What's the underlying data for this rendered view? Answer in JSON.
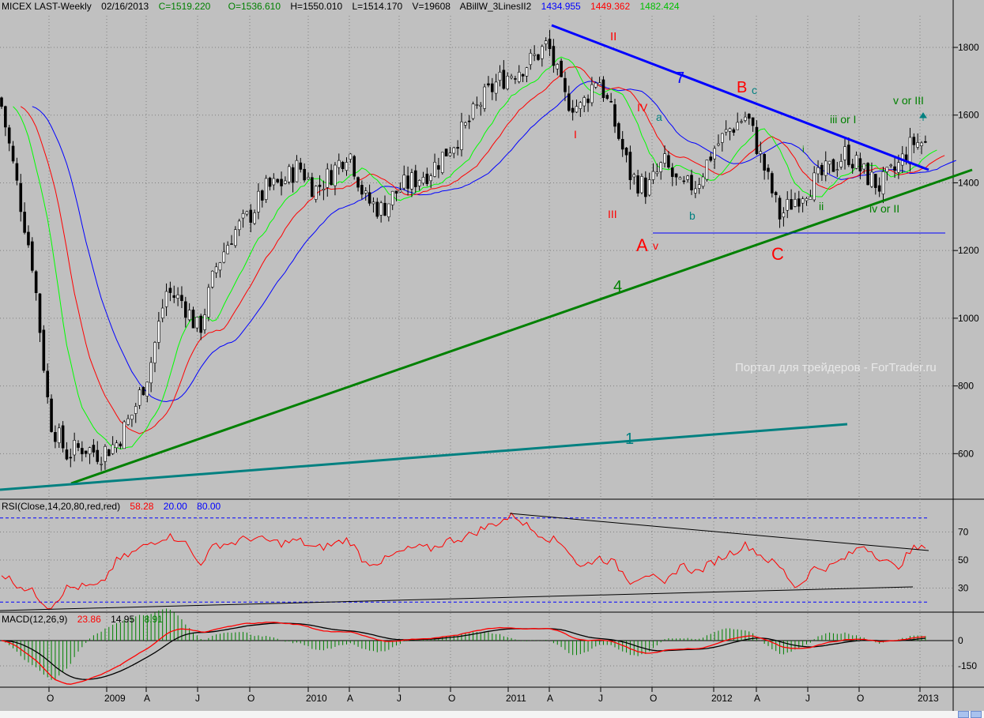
{
  "header": {
    "symbol": "MICEX LAST-Weekly",
    "date": "02/16/2013",
    "close": "C=1519.220",
    "open": "O=1536.610",
    "high": "H=1550.010",
    "low": "L=1514.170",
    "volume": "V=19608",
    "indicator": "ABillW_3LinesII2",
    "ind_v1": "1434.955",
    "ind_v2": "1449.362",
    "ind_v3": "1482.424"
  },
  "rsi_header": {
    "label": "RSI(Close,14,20,80,red,red)",
    "value": "58.28",
    "low": "20.00",
    "high": "80.00"
  },
  "macd_header": {
    "label": "MACD(12,26,9)",
    "macd": "23.86",
    "signal": "14.95",
    "hist": "8.91"
  },
  "watermark": "Портал для трейдеров - ForTrader.ru",
  "colors": {
    "bg": "#c0c0c0",
    "jaw": "#0000ff",
    "teeth": "#ff0000",
    "lips": "#00ff00",
    "line7": "#0000ff",
    "line4": "#008000",
    "line1": "#008080"
  },
  "price_axis": [
    "1800",
    "1600",
    "1400",
    "1200",
    "1000",
    "800",
    "600"
  ],
  "rsi_axis": [
    "70",
    "50",
    "30"
  ],
  "macd_axis": [
    "0",
    "-150"
  ],
  "date_axis": [
    "O",
    "2009",
    "A",
    "J",
    "O",
    "2010",
    "A",
    "J",
    "O",
    "2011",
    "A",
    "J",
    "O",
    "2012",
    "A",
    "J",
    "O",
    "2013"
  ],
  "wave_labels": {
    "II": "II",
    "seven": "7",
    "B": "B",
    "c": "c",
    "IV": "IV",
    "a": "a",
    "I": "I",
    "III": "III",
    "b": "b",
    "A": "A",
    "v": "v",
    "C": "C",
    "four": "4",
    "one": "1",
    "iii": "iii or I",
    "vIII": "v or III",
    "i": "i",
    "ii": "ii",
    "ivII": "iv or II"
  },
  "chart_data": {
    "type": "candlestick",
    "title": "MICEX LAST-Weekly",
    "ylim": [
      450,
      1900
    ],
    "months": [
      "2008-07",
      "2008-08",
      "2008-09",
      "2008-10",
      "2008-11",
      "2008-12",
      "2009-01",
      "2009-02",
      "2009-03",
      "2009-04",
      "2009-05",
      "2009-06",
      "2009-07",
      "2009-08",
      "2009-09",
      "2009-10",
      "2009-11",
      "2009-12",
      "2010-01",
      "2010-02",
      "2010-03",
      "2010-04",
      "2010-05",
      "2010-06",
      "2010-07",
      "2010-08",
      "2010-09",
      "2010-10",
      "2010-11",
      "2010-12",
      "2011-01",
      "2011-02",
      "2011-03",
      "2011-04",
      "2011-05",
      "2011-06",
      "2011-07",
      "2011-08",
      "2011-09",
      "2011-10",
      "2011-11",
      "2011-12",
      "2012-01",
      "2012-02",
      "2012-03",
      "2012-04",
      "2012-05",
      "2012-06",
      "2012-07",
      "2012-08",
      "2012-09",
      "2012-10",
      "2012-11",
      "2012-12",
      "2013-01",
      "2013-02"
    ],
    "monthly_close": [
      1650,
      1400,
      1150,
      700,
      600,
      620,
      600,
      630,
      720,
      850,
      1080,
      1050,
      960,
      1150,
      1250,
      1300,
      1380,
      1400,
      1450,
      1380,
      1430,
      1500,
      1350,
      1320,
      1380,
      1410,
      1440,
      1500,
      1560,
      1640,
      1700,
      1730,
      1760,
      1810,
      1650,
      1620,
      1720,
      1580,
      1420,
      1380,
      1460,
      1380,
      1400,
      1500,
      1560,
      1600,
      1450,
      1300,
      1360,
      1400,
      1440,
      1490,
      1430,
      1390,
      1440,
      1519
    ],
    "rsi_monthly": [
      41,
      33,
      27,
      16,
      30,
      31,
      31,
      49,
      55,
      62,
      67,
      65,
      47,
      61,
      62,
      66,
      64,
      62,
      64,
      58,
      61,
      65,
      48,
      49,
      55,
      59,
      58,
      64,
      66,
      72,
      77,
      82,
      72,
      66,
      61,
      44,
      52,
      48,
      35,
      41,
      31,
      47,
      41,
      49,
      55,
      61,
      52,
      45,
      30,
      44,
      45,
      52,
      61,
      52,
      44,
      58
    ],
    "rsi_levels": [
      20,
      80
    ],
    "macd_params": [
      12,
      26,
      9
    ],
    "ma_lines": [
      "jaw",
      "teeth",
      "lips"
    ]
  }
}
